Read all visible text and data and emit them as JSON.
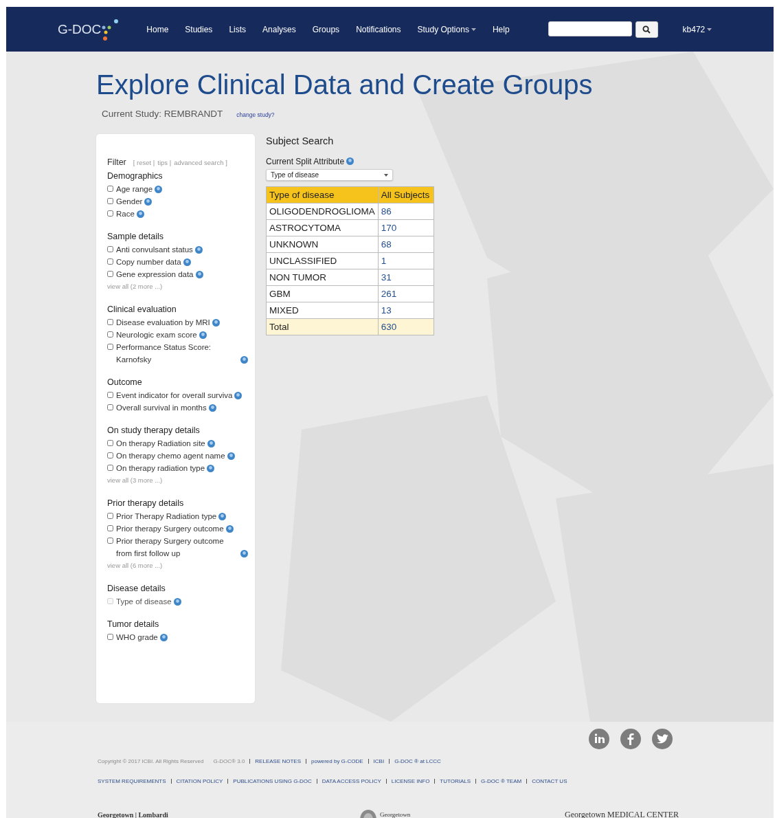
{
  "navbar": {
    "logo": "G-DOC",
    "items": [
      {
        "label": "Home",
        "dropdown": false
      },
      {
        "label": "Studies",
        "dropdown": false
      },
      {
        "label": "Lists",
        "dropdown": false
      },
      {
        "label": "Analyses",
        "dropdown": false
      },
      {
        "label": "Groups",
        "dropdown": false
      },
      {
        "label": "Notifications",
        "dropdown": false
      },
      {
        "label": "Study Options",
        "dropdown": true
      },
      {
        "label": "Help",
        "dropdown": false
      }
    ],
    "user": "kb472"
  },
  "page": {
    "title": "Explore Clinical Data and Create Groups",
    "current_study": "Current Study: REMBRANDT",
    "change_study": "change study?"
  },
  "filter": {
    "title": "Filter",
    "links": [
      "[ reset |",
      "tips |",
      "advanced search ]"
    ],
    "sections": [
      {
        "title": "Demographics",
        "items": [
          {
            "label": "Age range",
            "checked": false
          },
          {
            "label": "Gender",
            "checked": false
          },
          {
            "label": "Race",
            "checked": false
          }
        ]
      },
      {
        "title": "Sample details",
        "items": [
          {
            "label": "Anti convulsant status",
            "checked": false
          },
          {
            "label": "Copy number data",
            "checked": false
          },
          {
            "label": "Gene expression data",
            "checked": false
          }
        ],
        "more": "view all (2 more ...)"
      },
      {
        "title": "Clinical evaluation",
        "items": [
          {
            "label": "Disease evaluation by MRI",
            "checked": false
          },
          {
            "label": "Neurologic exam score",
            "checked": false
          },
          {
            "label": "Performance Status Score: Karnofsky",
            "checked": false
          }
        ]
      },
      {
        "title": "Outcome",
        "items": [
          {
            "label": "Event indicator for overall surviva",
            "checked": false
          },
          {
            "label": "Overall survival in months",
            "checked": false
          }
        ]
      },
      {
        "title": "On study therapy details",
        "items": [
          {
            "label": "On therapy Radiation site",
            "checked": false
          },
          {
            "label": "On therapy chemo agent name",
            "checked": false
          },
          {
            "label": "On therapy radiation type",
            "checked": false
          }
        ],
        "more": "view all (3 more ...)"
      },
      {
        "title": "Prior therapy details",
        "items": [
          {
            "label": "Prior Therapy Radiation type",
            "checked": false
          },
          {
            "label": "Prior therapy Surgery outcome",
            "checked": false
          },
          {
            "label": "Prior therapy Surgery outcome from first follow up",
            "checked": false
          }
        ],
        "more": "view all (6 more ...)"
      },
      {
        "title": "Disease details",
        "items": [
          {
            "label": "Type of disease",
            "checked": false,
            "disabled": true
          }
        ]
      },
      {
        "title": "Tumor details",
        "items": [
          {
            "label": "WHO grade",
            "checked": false
          }
        ]
      }
    ]
  },
  "subject_search": {
    "title": "Subject Search",
    "split_label": "Current Split Attribute",
    "split_value": "Type of disease",
    "columns": [
      "Type of disease",
      "All Subjects"
    ],
    "rows": [
      {
        "name": "OLIGODENDROGLIOMA",
        "count": "86"
      },
      {
        "name": "ASTROCYTOMA",
        "count": "170"
      },
      {
        "name": "UNKNOWN",
        "count": "68"
      },
      {
        "name": "UNCLASSIFIED",
        "count": "1"
      },
      {
        "name": "NON TUMOR",
        "count": "31"
      },
      {
        "name": "GBM",
        "count": "261"
      },
      {
        "name": "MIXED",
        "count": "13"
      }
    ],
    "total": {
      "name": "Total",
      "count": "630"
    }
  },
  "footer": {
    "copyright": "Copyright © 2017 ICBI. All Rights Reserved",
    "version": "G-DOC® 3.0",
    "links_1": [
      "RELEASE NOTES",
      "powered by G-CODE",
      "ICBI",
      "G-DOC ® at LCCC"
    ],
    "links_2": [
      "SYSTEM REQUIREMENTS",
      "CITATION POLICY",
      "PUBLICATIONS USING G-DOC",
      "DATA ACCESS POLICY",
      "LICENSE INFO",
      "TUTORIALS",
      "G-DOC ® TEAM",
      "CONTACT US"
    ],
    "logos": [
      "Georgetown | Lombardi",
      "Georgetown",
      "Georgetown MEDICAL CENTER"
    ]
  }
}
